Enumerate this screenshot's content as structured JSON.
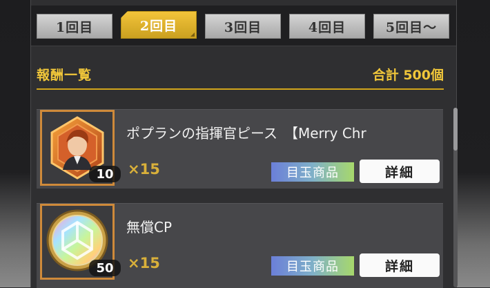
{
  "tabs": [
    {
      "label": "1回目",
      "active": false
    },
    {
      "label": "2回目",
      "active": true
    },
    {
      "label": "3回目",
      "active": false
    },
    {
      "label": "4回目",
      "active": false
    },
    {
      "label": "5回目〜",
      "active": false
    }
  ],
  "header": {
    "title": "報酬一覧",
    "total": "合計 500個"
  },
  "items": [
    {
      "name": "ポプランの指揮官ピース　【Merry Chr",
      "badge": "10",
      "multiplier": "×15",
      "tag": "目玉商品",
      "detail_label": "詳細",
      "icon": "hexagon-commander-icon"
    },
    {
      "name": "無償CP",
      "badge": "50",
      "multiplier": "×15",
      "tag": "目玉商品",
      "detail_label": "詳細",
      "icon": "rainbow-coin-icon"
    }
  ],
  "colors": {
    "accent": "#f0c63a",
    "active_tab": "#e6b82d",
    "item_bg": "#47474a",
    "thumb_border": "#cf8a3a"
  }
}
